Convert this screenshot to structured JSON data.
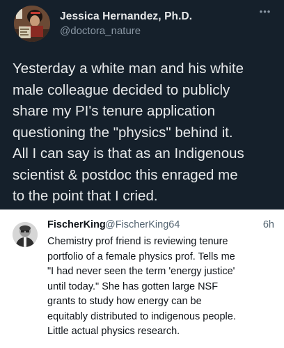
{
  "post": {
    "author_name": "Jessica Hernandez, Ph.D.",
    "author_handle": "@doctora_nature",
    "more_icon": "more-horizontal-icon",
    "text_lines": [
      "Yesterday a white man and his white",
      "male colleague decided to publicly",
      "share my PI's tenure application",
      "questioning the \"physics\" behind it.",
      "All I can say is that as an Indigenous",
      "scientist & postdoc this enraged me",
      "to the point that I cried."
    ]
  },
  "quoted_post": {
    "author_name": "FischerKing",
    "author_handle": "@FischerKing64",
    "time": "6h",
    "text_lines": [
      "Chemistry prof friend is reviewing tenure",
      "portfolio of a female physics prof. Tells me",
      "\"I had never seen the term 'energy justice'",
      "until today.\" She has gotten large NSF",
      "grants to study how energy can be",
      "equitably distributed to indigenous people.",
      "Little actual physics research."
    ]
  },
  "colors": {
    "dark_background": "#15202b",
    "dark_text": "#e7e9ea",
    "dark_secondary": "#8b98a5",
    "light_text": "#0f1419",
    "light_secondary": "#536471"
  }
}
